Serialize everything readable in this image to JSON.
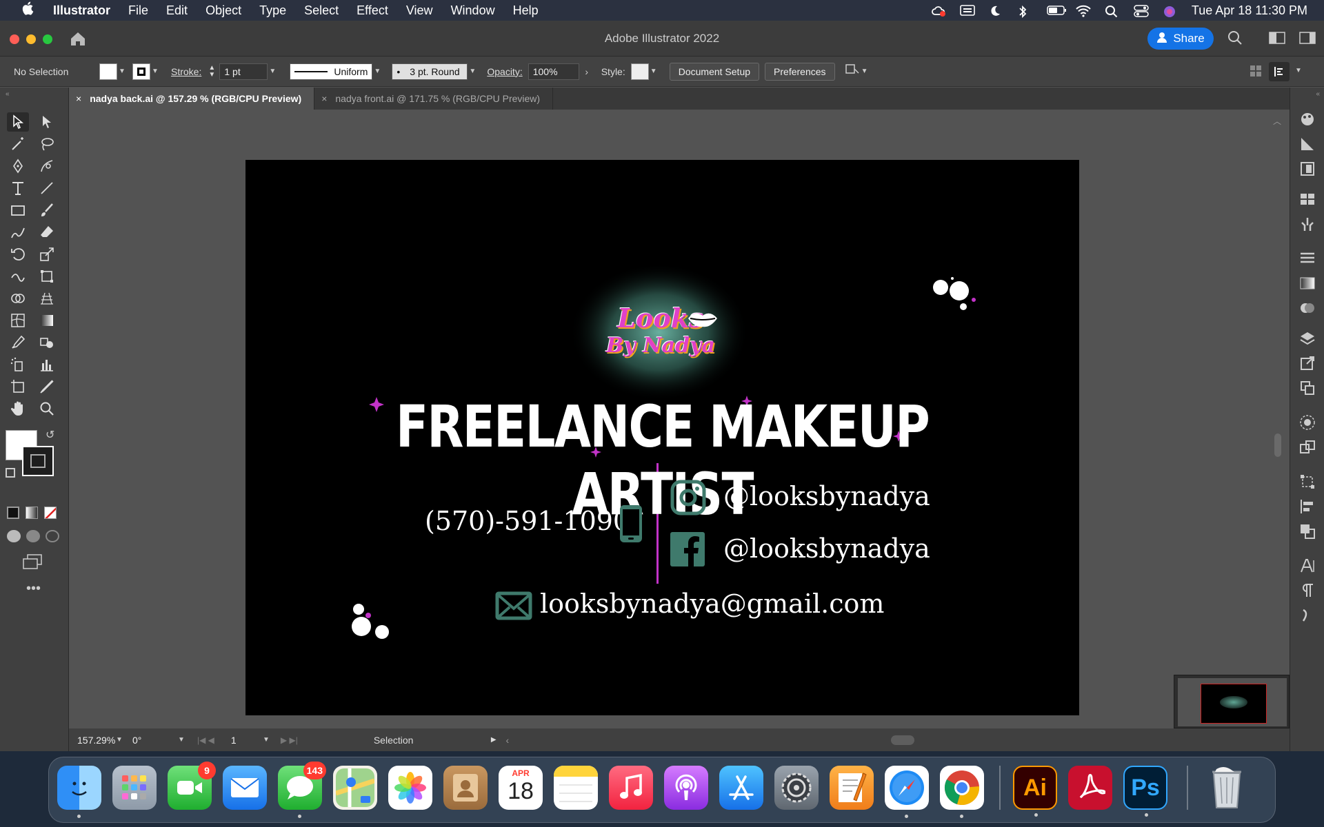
{
  "menubar": {
    "app_name": "Illustrator",
    "items": [
      "File",
      "Edit",
      "Object",
      "Type",
      "Select",
      "Effect",
      "View",
      "Window",
      "Help"
    ],
    "clock": "Tue Apr 18  11:30 PM"
  },
  "window": {
    "title": "Adobe Illustrator 2022",
    "share_label": "Share"
  },
  "control_bar": {
    "selection_label": "No Selection",
    "stroke_label": "Stroke:",
    "stroke_weight": "1 pt",
    "profile_label": "Uniform",
    "brush_label": "3 pt. Round",
    "opacity_label": "Opacity:",
    "opacity_value": "100%",
    "style_label": "Style:",
    "document_setup": "Document Setup",
    "preferences": "Preferences"
  },
  "tabs": [
    {
      "label": "nadya back.ai @ 157.29 % (RGB/CPU Preview)",
      "active": true
    },
    {
      "label": "nadya front.ai @ 171.75 % (RGB/CPU Preview)",
      "active": false
    }
  ],
  "artwork": {
    "logo_line1": "Looks",
    "logo_line2": "By Nadya",
    "headline": "FREELANCE MAKEUP ARTIST",
    "phone": "(570)-591-1090",
    "instagram": "@looksbynadya",
    "facebook": "@looksbynadya",
    "email": "looksbynadya@gmail.com",
    "accent_color": "#c233c8",
    "icon_color": "#3f7a6c"
  },
  "status_bar": {
    "zoom": "157.29%",
    "rotation": "0°",
    "artboard_number": "1",
    "tool_name": "Selection"
  },
  "dock": {
    "facetime_badge": "9",
    "messages_badge": "143",
    "calendar_month": "APR",
    "calendar_day": "18",
    "illustrator_label": "Ai",
    "photoshop_label": "Ps"
  }
}
